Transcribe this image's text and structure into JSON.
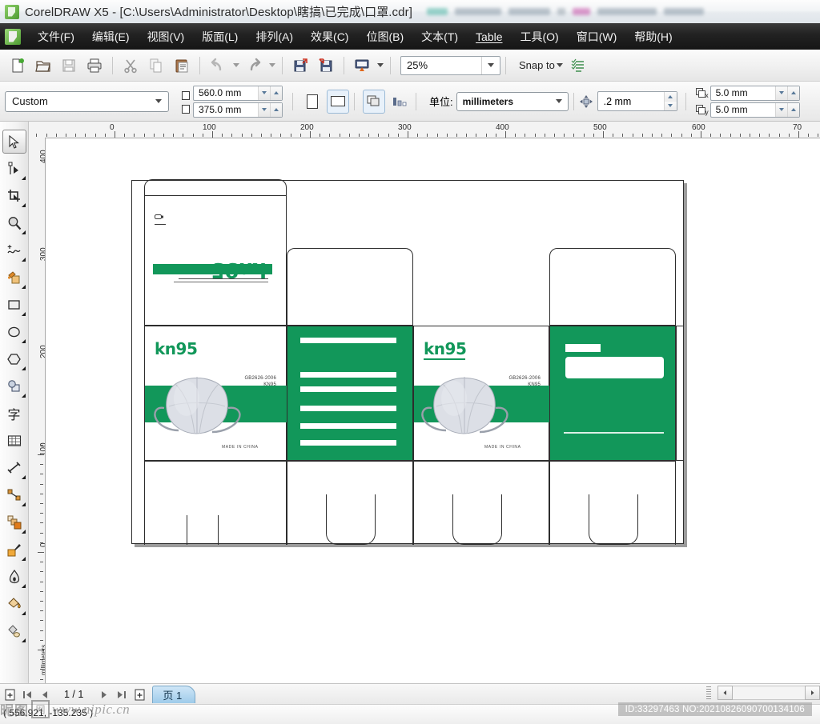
{
  "window": {
    "title": "CorelDRAW X5 - [C:\\Users\\Administrator\\Desktop\\瞎搞\\已完成\\口罩.cdr]",
    "app_icon": "coreldraw-icon"
  },
  "menubar": {
    "items": [
      {
        "label": "文件(F)",
        "name": "menu-file"
      },
      {
        "label": "编辑(E)",
        "name": "menu-edit"
      },
      {
        "label": "视图(V)",
        "name": "menu-view"
      },
      {
        "label": "版面(L)",
        "name": "menu-layout"
      },
      {
        "label": "排列(A)",
        "name": "menu-arrange"
      },
      {
        "label": "效果(C)",
        "name": "menu-effects"
      },
      {
        "label": "位图(B)",
        "name": "menu-bitmaps"
      },
      {
        "label": "文本(T)",
        "name": "menu-text"
      },
      {
        "label": "Table",
        "name": "menu-table"
      },
      {
        "label": "工具(O)",
        "name": "menu-tools"
      },
      {
        "label": "窗口(W)",
        "name": "menu-window"
      },
      {
        "label": "帮助(H)",
        "name": "menu-help"
      }
    ]
  },
  "toolbar": {
    "buttons": [
      {
        "name": "new-document-button",
        "icon": "new-file-icon"
      },
      {
        "name": "open-document-button",
        "icon": "open-folder-icon"
      },
      {
        "name": "save-document-button",
        "icon": "save-disk-icon"
      },
      {
        "name": "print-button",
        "icon": "printer-icon"
      },
      {
        "name": "cut-button",
        "icon": "scissors-icon"
      },
      {
        "name": "copy-button",
        "icon": "copy-icon"
      },
      {
        "name": "paste-button",
        "icon": "clipboard-icon"
      },
      {
        "name": "undo-button",
        "icon": "undo-arrow-icon"
      },
      {
        "name": "redo-button",
        "icon": "redo-arrow-icon"
      },
      {
        "name": "import-button",
        "icon": "import-icon"
      },
      {
        "name": "export-button",
        "icon": "export-icon"
      },
      {
        "name": "application-launcher-button",
        "icon": "screen-icon"
      }
    ],
    "zoom_level": "25%",
    "snap_to_label": "Snap to",
    "options_icon": "options-list-icon"
  },
  "propertybar": {
    "page_preset": "Custom",
    "page_width": "560.0 mm",
    "page_height": "375.0 mm",
    "orientation_portrait": "portrait-button",
    "orientation_landscape": "landscape-button",
    "all_pages_icon": "all-pages-icon",
    "current_page_icon": "current-page-icon",
    "units_label": "单位:",
    "units_value": "millimeters",
    "nudge_offset": ".2 mm",
    "duplicate_x": "5.0 mm",
    "duplicate_y": "5.0 mm",
    "dup_x_label": "x",
    "dup_y_label": "y"
  },
  "toolbox": {
    "tools": [
      {
        "name": "pick-tool",
        "icon": "arrow-cursor-icon",
        "selected": true,
        "flyout": false
      },
      {
        "name": "shape-tool",
        "icon": "shape-node-icon",
        "selected": false,
        "flyout": true
      },
      {
        "name": "crop-tool",
        "icon": "crop-icon",
        "selected": false,
        "flyout": true
      },
      {
        "name": "zoom-tool",
        "icon": "magnifier-icon",
        "selected": false,
        "flyout": true
      },
      {
        "name": "freehand-tool",
        "icon": "freehand-curve-icon",
        "selected": false,
        "flyout": true
      },
      {
        "name": "smart-fill-tool",
        "icon": "smart-fill-icon",
        "selected": false,
        "flyout": true
      },
      {
        "name": "rectangle-tool",
        "icon": "rectangle-icon",
        "selected": false,
        "flyout": true
      },
      {
        "name": "ellipse-tool",
        "icon": "ellipse-icon",
        "selected": false,
        "flyout": true
      },
      {
        "name": "polygon-tool",
        "icon": "polygon-icon",
        "selected": false,
        "flyout": true
      },
      {
        "name": "basic-shapes-tool",
        "icon": "basic-shapes-icon",
        "selected": false,
        "flyout": true
      },
      {
        "name": "text-tool",
        "icon": "text-character-icon",
        "selected": false,
        "flyout": false
      },
      {
        "name": "table-tool",
        "icon": "table-grid-icon",
        "selected": false,
        "flyout": false
      },
      {
        "name": "dimension-tool",
        "icon": "dimension-icon",
        "selected": false,
        "flyout": true
      },
      {
        "name": "connector-tool",
        "icon": "connector-icon",
        "selected": false,
        "flyout": true
      },
      {
        "name": "blend-tool",
        "icon": "blend-shapes-icon",
        "selected": false,
        "flyout": true
      },
      {
        "name": "color-eyedropper-tool",
        "icon": "eyedropper-icon",
        "selected": false,
        "flyout": true
      },
      {
        "name": "outline-tool",
        "icon": "pen-nib-icon",
        "selected": false,
        "flyout": true
      },
      {
        "name": "fill-tool",
        "icon": "paint-bucket-icon",
        "selected": false,
        "flyout": true
      },
      {
        "name": "interactive-fill-tool",
        "icon": "interactive-fill-icon",
        "selected": false,
        "flyout": true
      }
    ],
    "text_tool_glyph": "字"
  },
  "rulers": {
    "unit_corner_label": "millimeters",
    "horizontal_labels": [
      "0",
      "100",
      "200",
      "300",
      "400",
      "500",
      "600",
      "70"
    ],
    "vertical_labels": [
      "400",
      "300",
      "200",
      "100",
      "0"
    ]
  },
  "artwork": {
    "brand": "kn95",
    "standard_line1": "GB2626-2006",
    "standard_line2": "KN95",
    "origin": "MADE IN CHINA",
    "green": "#12975a",
    "white_bar_count": 6,
    "panels": [
      {
        "name": "left-panel-top",
        "content": "kn95-rotated"
      },
      {
        "name": "left-panel-front",
        "content": "kn95-mask-front"
      },
      {
        "name": "green-info-panel",
        "content": "white-text-bars"
      },
      {
        "name": "center-panel-front",
        "content": "kn95-mask-front"
      },
      {
        "name": "green-label-panel",
        "content": "white-label-boxes"
      }
    ]
  },
  "pagebar": {
    "add-page-left": "add-page-icon",
    "first_page_icon": "first-page-icon",
    "prev_page_icon": "prev-page-icon",
    "page_counter": "1 / 1",
    "next_page_icon": "next-page-icon",
    "last_page_icon": "last-page-icon",
    "add-page-right": "add-page-icon",
    "page_tab_label": "页 1"
  },
  "statusbar": {
    "coordinates": "( 556.921, -135.235 )"
  },
  "watermarks": {
    "left_cn": "昵图",
    "left_box": "网",
    "left_url": "www.nipic.cn",
    "right_id": "ID:33297463 NO:20210826090700134106"
  }
}
